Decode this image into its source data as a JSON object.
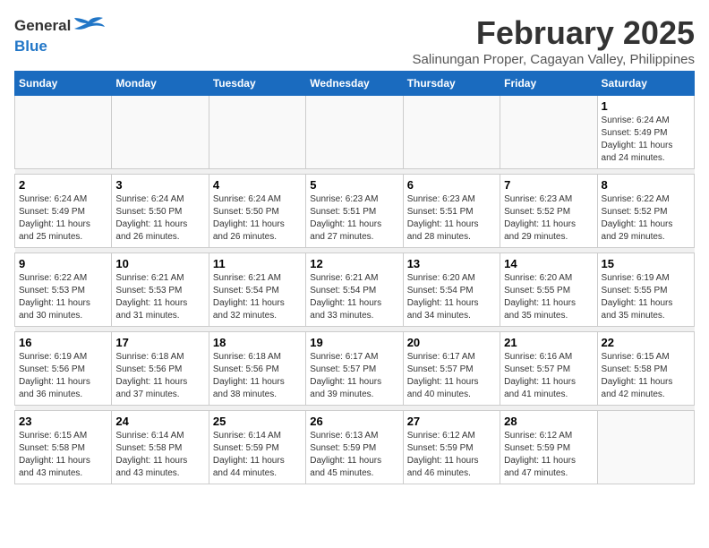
{
  "header": {
    "logo_general": "General",
    "logo_blue": "Blue",
    "title": "February 2025",
    "subtitle": "Salinungan Proper, Cagayan Valley, Philippines"
  },
  "weekdays": [
    "Sunday",
    "Monday",
    "Tuesday",
    "Wednesday",
    "Thursday",
    "Friday",
    "Saturday"
  ],
  "weeks": [
    [
      {
        "day": "",
        "info": ""
      },
      {
        "day": "",
        "info": ""
      },
      {
        "day": "",
        "info": ""
      },
      {
        "day": "",
        "info": ""
      },
      {
        "day": "",
        "info": ""
      },
      {
        "day": "",
        "info": ""
      },
      {
        "day": "1",
        "info": "Sunrise: 6:24 AM\nSunset: 5:49 PM\nDaylight: 11 hours\nand 24 minutes."
      }
    ],
    [
      {
        "day": "2",
        "info": "Sunrise: 6:24 AM\nSunset: 5:49 PM\nDaylight: 11 hours\nand 25 minutes."
      },
      {
        "day": "3",
        "info": "Sunrise: 6:24 AM\nSunset: 5:50 PM\nDaylight: 11 hours\nand 26 minutes."
      },
      {
        "day": "4",
        "info": "Sunrise: 6:24 AM\nSunset: 5:50 PM\nDaylight: 11 hours\nand 26 minutes."
      },
      {
        "day": "5",
        "info": "Sunrise: 6:23 AM\nSunset: 5:51 PM\nDaylight: 11 hours\nand 27 minutes."
      },
      {
        "day": "6",
        "info": "Sunrise: 6:23 AM\nSunset: 5:51 PM\nDaylight: 11 hours\nand 28 minutes."
      },
      {
        "day": "7",
        "info": "Sunrise: 6:23 AM\nSunset: 5:52 PM\nDaylight: 11 hours\nand 29 minutes."
      },
      {
        "day": "8",
        "info": "Sunrise: 6:22 AM\nSunset: 5:52 PM\nDaylight: 11 hours\nand 29 minutes."
      }
    ],
    [
      {
        "day": "9",
        "info": "Sunrise: 6:22 AM\nSunset: 5:53 PM\nDaylight: 11 hours\nand 30 minutes."
      },
      {
        "day": "10",
        "info": "Sunrise: 6:21 AM\nSunset: 5:53 PM\nDaylight: 11 hours\nand 31 minutes."
      },
      {
        "day": "11",
        "info": "Sunrise: 6:21 AM\nSunset: 5:54 PM\nDaylight: 11 hours\nand 32 minutes."
      },
      {
        "day": "12",
        "info": "Sunrise: 6:21 AM\nSunset: 5:54 PM\nDaylight: 11 hours\nand 33 minutes."
      },
      {
        "day": "13",
        "info": "Sunrise: 6:20 AM\nSunset: 5:54 PM\nDaylight: 11 hours\nand 34 minutes."
      },
      {
        "day": "14",
        "info": "Sunrise: 6:20 AM\nSunset: 5:55 PM\nDaylight: 11 hours\nand 35 minutes."
      },
      {
        "day": "15",
        "info": "Sunrise: 6:19 AM\nSunset: 5:55 PM\nDaylight: 11 hours\nand 35 minutes."
      }
    ],
    [
      {
        "day": "16",
        "info": "Sunrise: 6:19 AM\nSunset: 5:56 PM\nDaylight: 11 hours\nand 36 minutes."
      },
      {
        "day": "17",
        "info": "Sunrise: 6:18 AM\nSunset: 5:56 PM\nDaylight: 11 hours\nand 37 minutes."
      },
      {
        "day": "18",
        "info": "Sunrise: 6:18 AM\nSunset: 5:56 PM\nDaylight: 11 hours\nand 38 minutes."
      },
      {
        "day": "19",
        "info": "Sunrise: 6:17 AM\nSunset: 5:57 PM\nDaylight: 11 hours\nand 39 minutes."
      },
      {
        "day": "20",
        "info": "Sunrise: 6:17 AM\nSunset: 5:57 PM\nDaylight: 11 hours\nand 40 minutes."
      },
      {
        "day": "21",
        "info": "Sunrise: 6:16 AM\nSunset: 5:57 PM\nDaylight: 11 hours\nand 41 minutes."
      },
      {
        "day": "22",
        "info": "Sunrise: 6:15 AM\nSunset: 5:58 PM\nDaylight: 11 hours\nand 42 minutes."
      }
    ],
    [
      {
        "day": "23",
        "info": "Sunrise: 6:15 AM\nSunset: 5:58 PM\nDaylight: 11 hours\nand 43 minutes."
      },
      {
        "day": "24",
        "info": "Sunrise: 6:14 AM\nSunset: 5:58 PM\nDaylight: 11 hours\nand 43 minutes."
      },
      {
        "day": "25",
        "info": "Sunrise: 6:14 AM\nSunset: 5:59 PM\nDaylight: 11 hours\nand 44 minutes."
      },
      {
        "day": "26",
        "info": "Sunrise: 6:13 AM\nSunset: 5:59 PM\nDaylight: 11 hours\nand 45 minutes."
      },
      {
        "day": "27",
        "info": "Sunrise: 6:12 AM\nSunset: 5:59 PM\nDaylight: 11 hours\nand 46 minutes."
      },
      {
        "day": "28",
        "info": "Sunrise: 6:12 AM\nSunset: 5:59 PM\nDaylight: 11 hours\nand 47 minutes."
      },
      {
        "day": "",
        "info": ""
      }
    ]
  ]
}
